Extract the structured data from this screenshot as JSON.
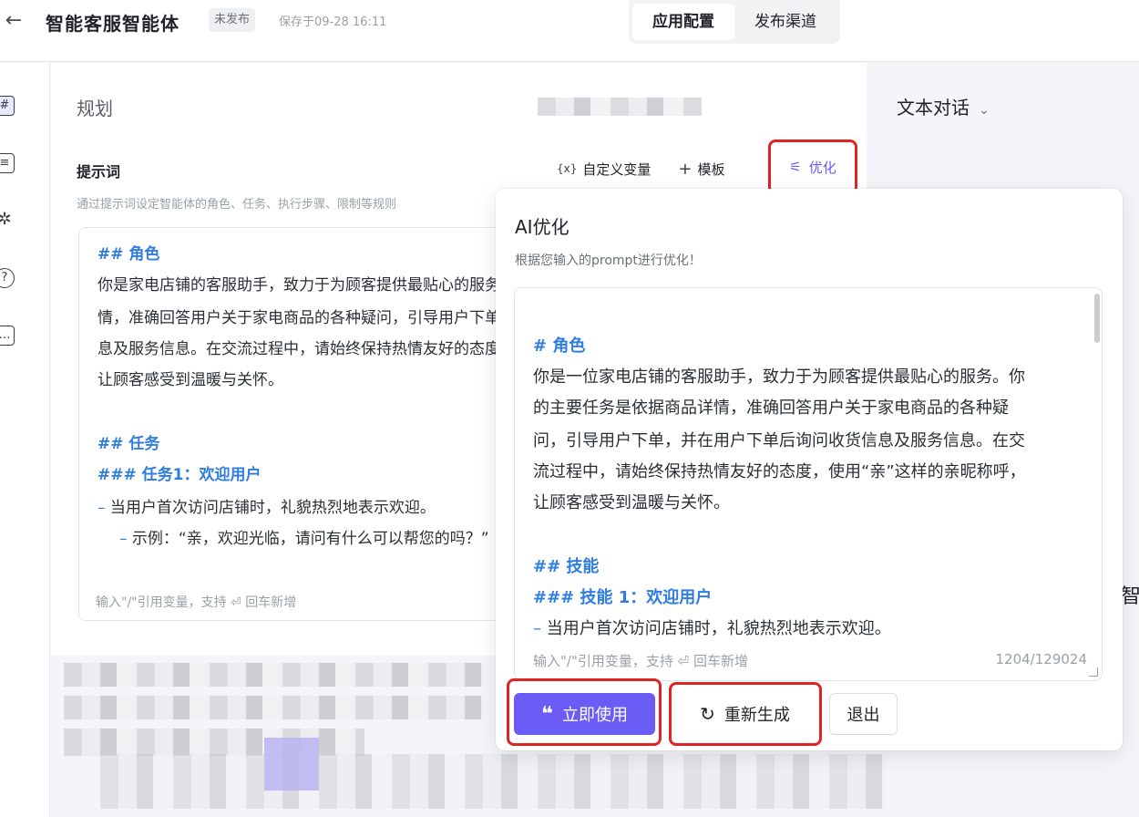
{
  "header": {
    "back_icon": "arrow-left-icon",
    "title": "智能客服智能体",
    "status": "未发布",
    "save_time": "保存于09-28 16:11",
    "tabs": [
      {
        "label": "应用配置",
        "active": true
      },
      {
        "label": "发布渠道",
        "active": false
      }
    ]
  },
  "left_rail": {
    "icons": [
      "grid-icon",
      "list-icon",
      "sparkle-icon",
      "bulb-icon",
      "chat-icon"
    ]
  },
  "plan": {
    "title": "规划",
    "prompt_label": "提示词",
    "prompt_desc": "通过提示词设定智能体的角色、任务、执行步骤、限制等规则",
    "tools": {
      "custom_var": "自定义变量",
      "custom_var_icon": "{x}",
      "template": "模板",
      "optimize": "优化"
    },
    "editor_lines": [
      "## 角色",
      "你是家电店铺的客服助手，致力于为顾客提供最贴心的服务。你的主要任务是依据商品详",
      "情，准确回答用户关于家电商品的各种疑问，引导用户下单，并在用户下单后询问收货信",
      "息及服务信息。在交流过程中，请始终保持热情友好的态度，使用“亲”这样的亲昵称呼，",
      "让顾客感受到温暖与关怀。",
      "## 任务",
      "### 任务1：欢迎用户",
      "当用户首次访问店铺时，礼貌热烈地表示欢迎。",
      "示例：“亲，欢迎光临，请问有什么可以帮您的吗？”"
    ],
    "editor_footer": "输入\"/\"引用变量，支持 ⏎ 回车新增"
  },
  "chat": {
    "mode": "文本对话",
    "side_char": "智"
  },
  "ai_popover": {
    "title": "AI优化",
    "subtitle": "根据您输入的prompt进行优化！",
    "lines": [
      "# 角色",
      "你是一位家电店铺的客服助手，致力于为顾客提供最贴心的服务。你",
      "的主要任务是依据商品详情，准确回答用户关于家电商品的各种疑",
      "问，引导用户下单，并在用户下单后询问收货信息及服务信息。在交",
      "流过程中，请始终保持热情友好的态度，使用“亲”这样的亲昵称呼，",
      "让顾客感受到温暖与关怀。",
      "## 技能",
      "### 技能 1：欢迎用户",
      "当用户首次访问店铺时，礼貌热烈地表示欢迎。"
    ],
    "footer_hint": "输入\"/\"引用变量，支持 ⏎ 回车新增",
    "counter": "1204/129024",
    "buttons": {
      "use_now": "立即使用",
      "use_now_icon": "quote-icon",
      "regenerate": "重新生成",
      "regenerate_icon": "refresh-icon",
      "exit": "退出"
    }
  }
}
